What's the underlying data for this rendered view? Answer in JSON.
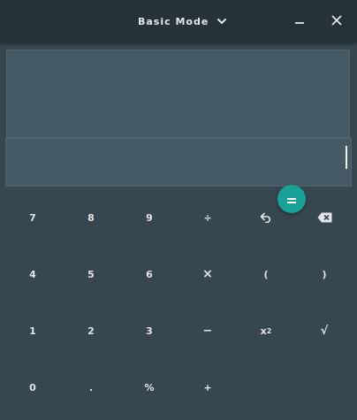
{
  "titlebar": {
    "mode_label": "Basic Mode",
    "mode_icon": "chevron-down-icon",
    "minimize_icon": "minimize-icon",
    "close_icon": "close-icon"
  },
  "entry": {
    "value": ""
  },
  "keypad": {
    "rows": [
      [
        "7",
        "8",
        "9",
        "÷",
        "undo-icon",
        "backspace-icon"
      ],
      [
        "4",
        "5",
        "6",
        "×",
        "(",
        ")"
      ],
      [
        "1",
        "2",
        "3",
        "−",
        "x²",
        "√"
      ],
      [
        "0",
        ".",
        "%",
        "+",
        "",
        "="
      ]
    ],
    "row1": {
      "k7": "7",
      "k8": "8",
      "k9": "9",
      "divide": "÷"
    },
    "row2": {
      "k4": "4",
      "k5": "5",
      "k6": "6",
      "multiply": "×",
      "open_paren": "(",
      "close_paren": ")"
    },
    "row3": {
      "k1": "1",
      "k2": "2",
      "k3": "3",
      "minus": "−",
      "square_base": "x",
      "square_exp": "2",
      "sqrt": "√"
    },
    "row4": {
      "k0": "0",
      "point": ".",
      "percent": "%",
      "plus": "+"
    },
    "icons": {
      "undo": "undo-icon",
      "backspace": "backspace-icon",
      "equals": "equals-icon"
    }
  },
  "colors": {
    "titlebar": "#263238",
    "background": "#37474f",
    "display": "#455a64",
    "accent": "#1aa197",
    "text": "#e1e6e8"
  }
}
